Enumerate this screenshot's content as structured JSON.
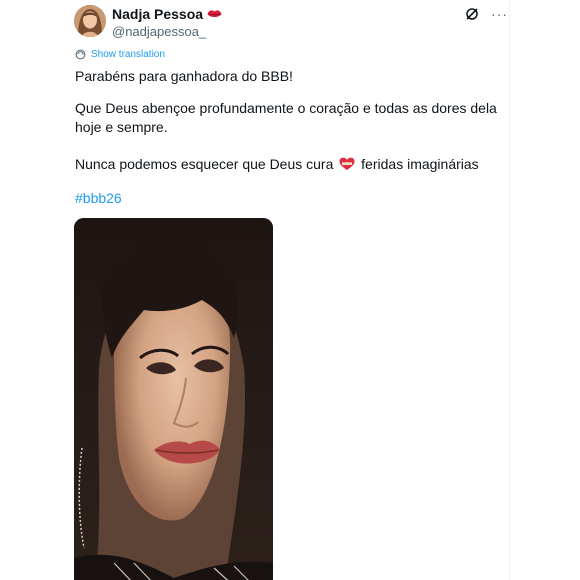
{
  "author": {
    "display_name": "Nadja Pessoa",
    "handle": "@nadjapessoa_",
    "badge_icon": "lips-icon",
    "avatar_icon": "avatar"
  },
  "actions": {
    "grok_icon": "grok-icon",
    "more_icon": "more-icon",
    "more_glyph": "···"
  },
  "translation": {
    "label": "Show translation",
    "icon": "globe-icon"
  },
  "text": {
    "line1": "Parabéns para ganhadora do BBB!",
    "line2": "Que Deus abençoe profundamente o coração e todas as dores dela hoje e sempre.",
    "line3_before": "Nunca podemos esquecer que Deus cura",
    "line3_after": "feridas imaginárias",
    "heart_icon": "mending-heart-icon"
  },
  "hashtag": "#bbb26",
  "media": {
    "kind": "photo",
    "subject": "woman-portrait"
  },
  "colors": {
    "link": "#1d9bf0",
    "text": "#0f1419",
    "secondary": "#536471",
    "badge": "#e0245e"
  }
}
